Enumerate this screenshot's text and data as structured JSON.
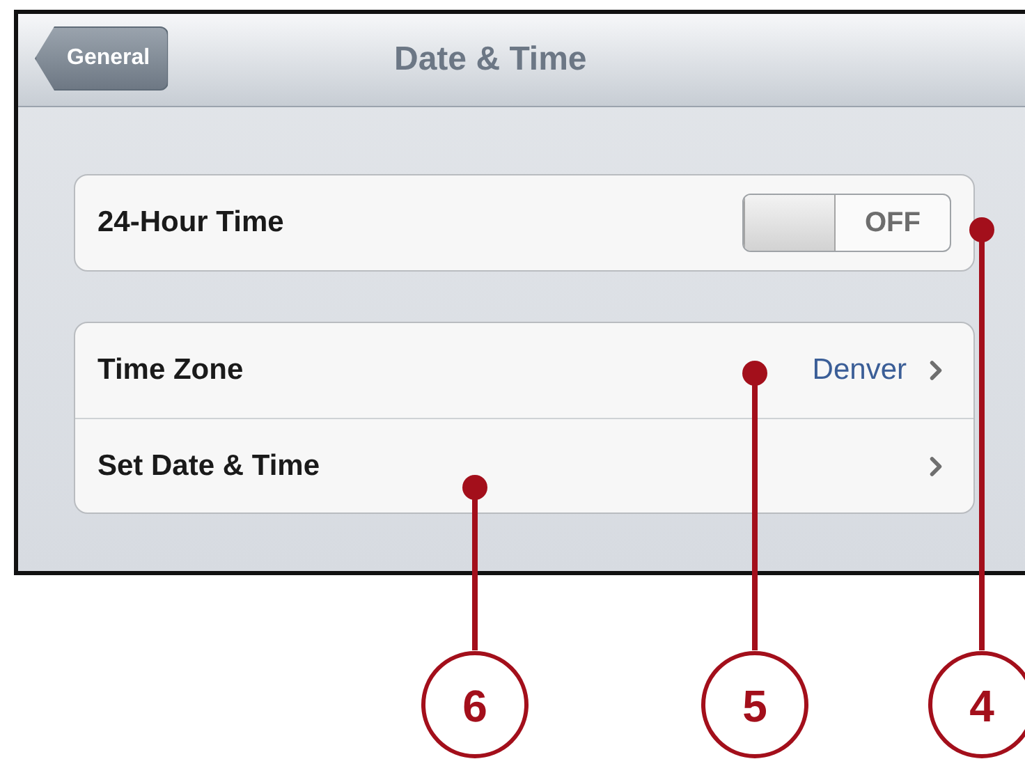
{
  "nav_bar": {
    "back_button": "General",
    "title": "Date & Time"
  },
  "groups": [
    {
      "rows": [
        {
          "kind": "toggle",
          "label": "24-Hour Time",
          "on": false,
          "toggle_text": "OFF"
        }
      ]
    },
    {
      "rows": [
        {
          "kind": "link",
          "label": "Time Zone",
          "value": "Denver"
        },
        {
          "kind": "link",
          "label": "Set Date & Time"
        }
      ]
    }
  ],
  "callouts": [
    "6",
    "5",
    "4"
  ]
}
